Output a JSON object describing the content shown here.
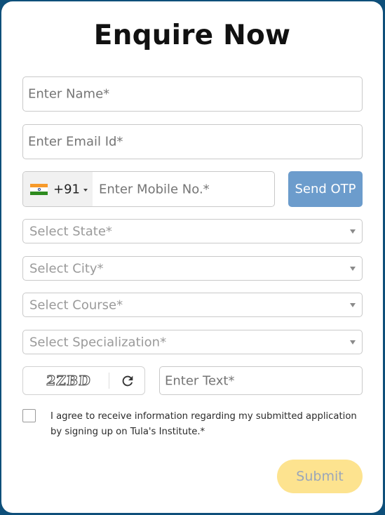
{
  "form": {
    "title": "Enquire Now",
    "name_placeholder": "Enter Name*",
    "email_placeholder": "Enter Email Id*",
    "phone": {
      "flag_icon": "india-flag-icon",
      "dial_code": "+91",
      "placeholder": "Enter Mobile No.*"
    },
    "send_otp_label": "Send OTP",
    "state_select": "Select State*",
    "city_select": "Select City*",
    "course_select": "Select Course*",
    "specialization_select": "Select Specialization*",
    "captcha": {
      "code": "2ZBD",
      "refresh_icon": "refresh-icon",
      "input_placeholder": "Enter Text*"
    },
    "consent_text": "I agree to receive information regarding my submitted application by signing up on Tula's Institute.*",
    "submit_label": "Submit"
  },
  "colors": {
    "otp_button": "#6c9ccc",
    "submit_button": "#fde38f",
    "frame_border": "#0e4f7a"
  }
}
